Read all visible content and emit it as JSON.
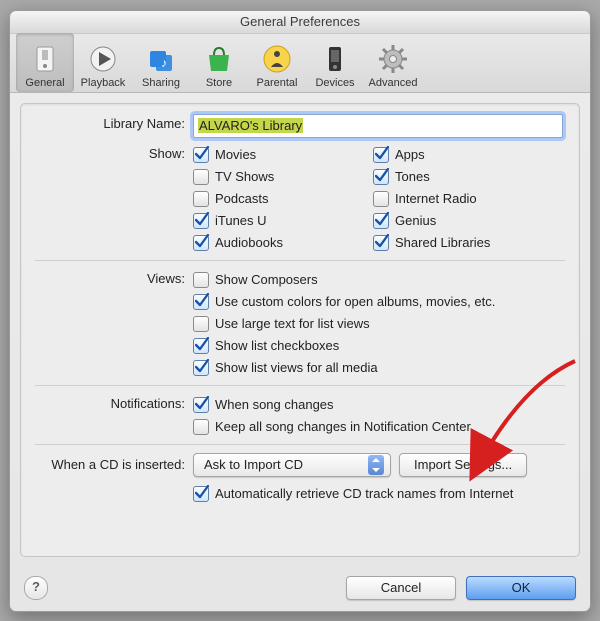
{
  "window": {
    "title": "General Preferences"
  },
  "toolbar": {
    "items": [
      {
        "label": "General"
      },
      {
        "label": "Playback"
      },
      {
        "label": "Sharing"
      },
      {
        "label": "Store"
      },
      {
        "label": "Parental"
      },
      {
        "label": "Devices"
      },
      {
        "label": "Advanced"
      }
    ]
  },
  "labels": {
    "library_name": "Library Name:",
    "show": "Show:",
    "views": "Views:",
    "notifications": "Notifications:",
    "cd_inserted": "When a CD is inserted:"
  },
  "library_name_value": "ALVARO's Library",
  "show_options": {
    "left": [
      {
        "label": "Movies",
        "checked": true
      },
      {
        "label": "TV Shows",
        "checked": false
      },
      {
        "label": "Podcasts",
        "checked": false
      },
      {
        "label": "iTunes U",
        "checked": true
      },
      {
        "label": "Audiobooks",
        "checked": true
      }
    ],
    "right": [
      {
        "label": "Apps",
        "checked": true
      },
      {
        "label": "Tones",
        "checked": true
      },
      {
        "label": "Internet Radio",
        "checked": false
      },
      {
        "label": "Genius",
        "checked": true
      },
      {
        "label": "Shared Libraries",
        "checked": true
      }
    ]
  },
  "views_options": [
    {
      "label": "Show Composers",
      "checked": false
    },
    {
      "label": "Use custom colors for open albums, movies, etc.",
      "checked": true
    },
    {
      "label": "Use large text for list views",
      "checked": false
    },
    {
      "label": "Show list checkboxes",
      "checked": true
    },
    {
      "label": "Show list views for all media",
      "checked": true
    }
  ],
  "notifications_options": [
    {
      "label": "When song changes",
      "checked": true
    },
    {
      "label": "Keep all song changes in Notification Center",
      "checked": false
    }
  ],
  "cd": {
    "popup_value": "Ask to Import CD",
    "import_button": "Import Settings...",
    "auto_retrieve_label": "Automatically retrieve CD track names from Internet",
    "auto_retrieve_checked": true
  },
  "buttons": {
    "help_tooltip": "?",
    "cancel": "Cancel",
    "ok": "OK"
  }
}
